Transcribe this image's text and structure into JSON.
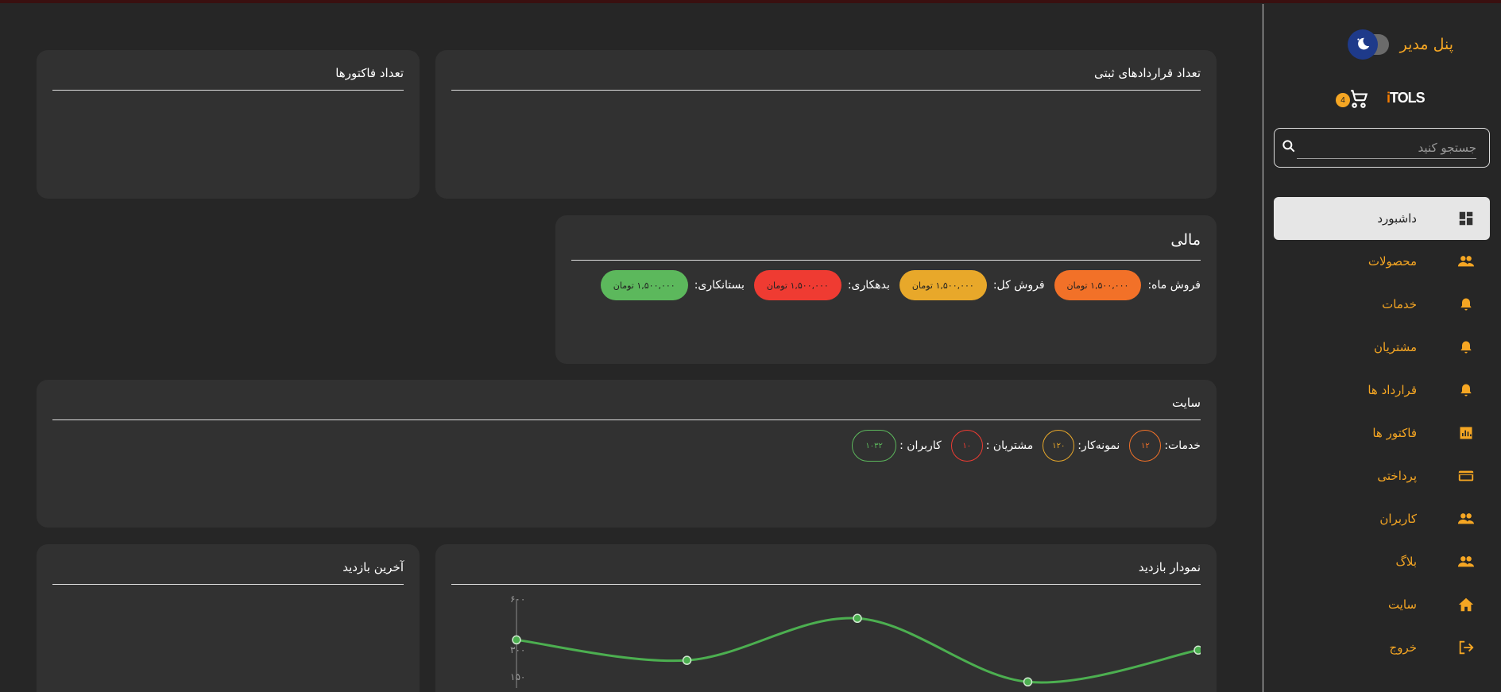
{
  "sidebar": {
    "panel_title": "پنل مدیر",
    "cart_count": "4",
    "logo_text": "TOLS",
    "search_placeholder": "جستجو کنید",
    "items": [
      {
        "label": "داشبورد",
        "icon": "dashboard-icon",
        "active": true
      },
      {
        "label": "محصولات",
        "icon": "people-icon"
      },
      {
        "label": "خدمات",
        "icon": "bell-icon"
      },
      {
        "label": "مشتریان",
        "icon": "bell-icon"
      },
      {
        "label": "قرارداد ها",
        "icon": "bell-icon"
      },
      {
        "label": "فاکتور ها",
        "icon": "bar-chart-icon"
      },
      {
        "label": "پرداختی",
        "icon": "credit-card-icon"
      },
      {
        "label": "کاربران",
        "icon": "people-icon"
      },
      {
        "label": "بلاگ",
        "icon": "people-icon"
      },
      {
        "label": "سایت",
        "icon": "home-icon"
      },
      {
        "label": "خروج",
        "icon": "logout-icon"
      }
    ]
  },
  "cards": {
    "contracts_title": "تعداد قراردادهای ثبتی",
    "invoices_title": "تعداد فاکتورها",
    "financial": {
      "title": "مالی",
      "monthly_label": "فروش ماه:",
      "monthly_value": "۱,۵۰۰,۰۰۰ تومان",
      "total_label": "فروش کل:",
      "total_value": "۱,۵۰۰,۰۰۰ تومان",
      "debt_label": "بدهکاری:",
      "debt_value": "۱,۵۰۰,۰۰۰ تومان",
      "credit_label": "بستانکاری:",
      "credit_value": "۱,۵۰۰,۰۰۰ تومان"
    },
    "site": {
      "title": "سایت",
      "services_label": "خدمات:",
      "services_value": "۱۲",
      "portfolio_label": "نمونه‌کار:",
      "portfolio_value": "۱۲۰",
      "customers_label": "مشتریان :",
      "customers_value": "۱۰",
      "users_label": "کاربران :",
      "users_value": "۱۰۳۲"
    },
    "visit_chart_title": "نمودار بازدید",
    "last_visit_title": "آخرین بازدید"
  },
  "colors": {
    "accent": "#f5a623",
    "orange": "#f27128",
    "yellow": "#e8a82a",
    "red": "#ef3b32",
    "green": "#5cb85c",
    "line": "#4caf50"
  },
  "chart_data": {
    "type": "line",
    "series": [
      {
        "values": [
          480,
          300,
          670,
          110,
          390
        ]
      }
    ],
    "y_ticks": [
      "۶۰۰",
      "۳۰۰",
      "۱۵۰"
    ],
    "ylim": [
      0,
      700
    ]
  }
}
